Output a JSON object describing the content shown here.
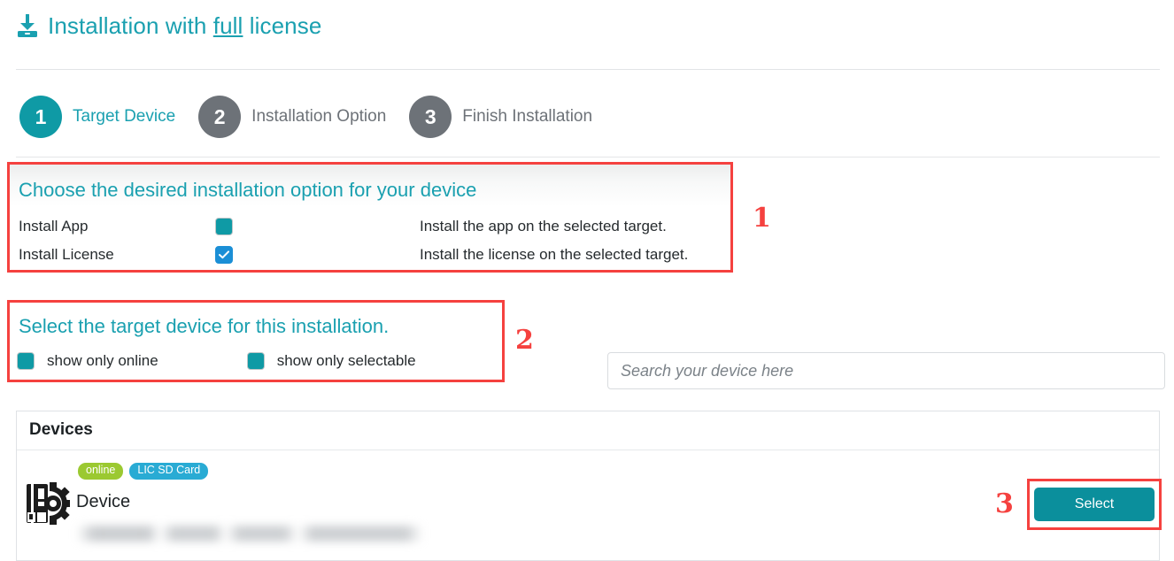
{
  "header": {
    "icon": "download-icon",
    "title_pre": "Installation with ",
    "title_underlined": "full",
    "title_post": " license"
  },
  "stepper": {
    "steps": [
      {
        "number": "1",
        "label": "Target Device",
        "state": "active"
      },
      {
        "number": "2",
        "label": "Installation Option",
        "state": "inactive"
      },
      {
        "number": "3",
        "label": "Finish Installation",
        "state": "inactive"
      }
    ]
  },
  "install_options": {
    "heading": "Choose the desired installation option for your device",
    "rows": [
      {
        "name": "Install App",
        "checked": "false",
        "description": "Install the app on the selected target."
      },
      {
        "name": "Install License",
        "checked": "true",
        "description": "Install the license on the selected target."
      }
    ]
  },
  "target_device": {
    "heading": "Select the target device for this installation.",
    "filters": [
      {
        "label": "show only online",
        "checked": "false"
      },
      {
        "label": "show only selectable",
        "checked": "false"
      }
    ]
  },
  "search": {
    "placeholder": "Search your device here",
    "value": ""
  },
  "devices_panel": {
    "title": "Devices",
    "row": {
      "icon": "device-gear-icon",
      "badges": [
        {
          "label": "online",
          "color": "#9bc931"
        },
        {
          "label": "LIC SD Card",
          "color": "#29abd4"
        }
      ],
      "name": "Device",
      "detail_redacted": "",
      "select_label": "Select"
    }
  },
  "annotations": [
    {
      "number": "1"
    },
    {
      "number": "2"
    },
    {
      "number": "3"
    }
  ],
  "colors": {
    "teal": "#0f9aa5",
    "teal_text": "#1aa0b0",
    "gray_step": "#6d7278",
    "annotation_red": "#f5413f",
    "checkbox_checked_blue": "#1b8fd6",
    "badge_green": "#9bc931",
    "badge_cyan": "#29abd4",
    "button_teal": "#0b8f9c"
  }
}
